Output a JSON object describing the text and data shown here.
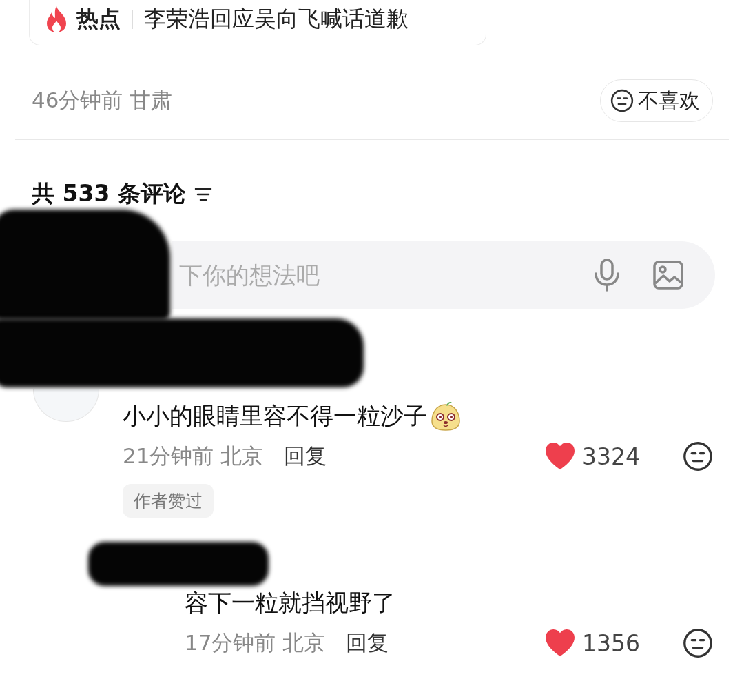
{
  "hot_topic": {
    "label": "热点",
    "title": "李荣浩回应吴向飞喊话道歉"
  },
  "post_meta": {
    "time": "46分钟前",
    "location": "甘肃"
  },
  "dislike_button": {
    "label": "不喜欢"
  },
  "comments_header": {
    "count_text": "共 533 条评论"
  },
  "comment_input": {
    "placeholder": "下你的想法吧"
  },
  "comments": [
    {
      "text": "小小的眼睛里容不得一粒沙子",
      "emoji": true,
      "time": "21分钟前",
      "location": "北京",
      "reply_label": "回复",
      "likes": "3324",
      "liked": true,
      "badge": "作者赞过",
      "replies": [
        {
          "text": "容下一粒就挡视野了",
          "emoji": false,
          "time": "17分钟前",
          "location": "北京",
          "reply_label": "回复",
          "likes": "1356",
          "liked": true
        }
      ]
    }
  ]
}
